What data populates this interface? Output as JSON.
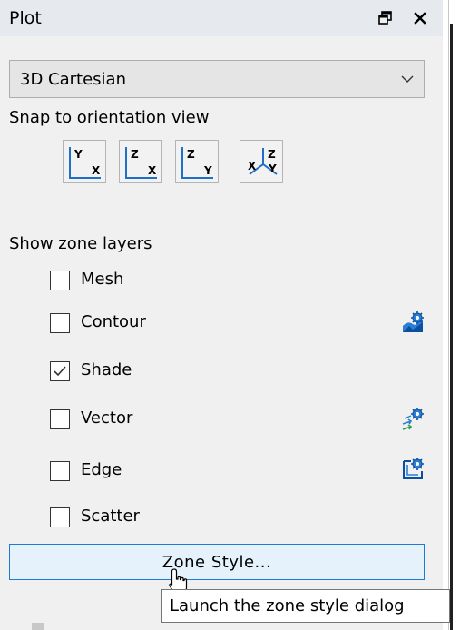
{
  "panel": {
    "title": "Plot",
    "float_icon": "float-window-icon",
    "close_icon": "close-icon"
  },
  "plot_type": {
    "selected": "3D Cartesian"
  },
  "orientation": {
    "heading": "Snap to orientation view",
    "buttons": [
      {
        "name": "orient-xy-button",
        "top_axis": "Y",
        "right_axis": "X"
      },
      {
        "name": "orient-xz-button",
        "top_axis": "Z",
        "right_axis": "X"
      },
      {
        "name": "orient-yz-button",
        "top_axis": "Z",
        "right_axis": "Y"
      },
      {
        "name": "orient-3d-button",
        "axes": [
          "X",
          "Y",
          "Z"
        ]
      }
    ]
  },
  "zone_layers": {
    "heading": "Show zone layers",
    "items": [
      {
        "label": "Mesh",
        "checked": false
      },
      {
        "label": "Contour",
        "checked": false,
        "settings_icon": "contour-settings-icon"
      },
      {
        "label": "Shade",
        "checked": true
      },
      {
        "label": "Vector",
        "checked": false,
        "settings_icon": "vector-settings-icon"
      },
      {
        "label": "Edge",
        "checked": false,
        "settings_icon": "edge-settings-icon"
      },
      {
        "label": "Scatter",
        "checked": false
      }
    ]
  },
  "zone_style_button": {
    "label": "Zone Style..."
  },
  "tooltip": {
    "text": "Launch the zone style dialog"
  },
  "colors": {
    "panel_bg": "#f0f0f0",
    "titlebar_bg": "#e6eaef",
    "button_hover_border": "#1f7ad4",
    "button_hover_bg": "#e5f1fb",
    "axis_blue": "#1e6fc8"
  }
}
